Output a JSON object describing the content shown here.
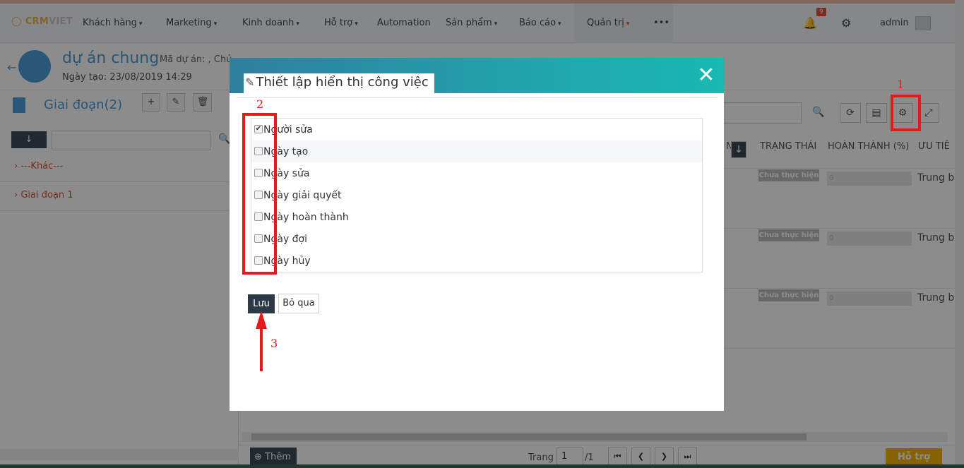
{
  "navbar": {
    "logo_main": "CRM",
    "logo_sub": "VIET",
    "items": [
      {
        "label": "Khách hàng",
        "caret": "▾"
      },
      {
        "label": "Marketing",
        "caret": "▾"
      },
      {
        "label": "Kinh doanh",
        "caret": "▾"
      },
      {
        "label": "Hỗ trợ",
        "caret": "▾"
      },
      {
        "label": "Automation",
        "caret": ""
      },
      {
        "label": "Sản phẩm",
        "caret": "▾"
      },
      {
        "label": "Báo cáo",
        "caret": "▾"
      },
      {
        "label": "Quản trị",
        "caret": "▾"
      },
      {
        "label": "•••",
        "caret": ""
      }
    ],
    "notif_count": "9",
    "user": "admin"
  },
  "project": {
    "title": "dự án chung",
    "code_label": "Mã dự án: ,  Chủ ..",
    "created": "Ngày tạo: 23/08/2019 14:29"
  },
  "left": {
    "stage_title": "Giai đoạn(2)",
    "sort_icon": "↓",
    "groups": [
      {
        "label": "---Khác---"
      },
      {
        "label": "Giai đoạn 1"
      }
    ]
  },
  "right": {
    "columns": [
      "N",
      "TRẠNG THÁI",
      "HOÀN THÀNH (%)",
      "ƯU TIÊ"
    ],
    "rows": [
      {
        "status": "Chưa thực hiện",
        "progress": "0",
        "priority": "Trung b"
      },
      {
        "status": "Chưa thực hiện",
        "progress": "0",
        "priority": "Trung b"
      },
      {
        "status": "Chưa thực hiện",
        "progress": "0",
        "priority": "Trung b"
      }
    ],
    "add_label": "Thêm",
    "page_label": "Trang",
    "page_value": "1",
    "page_total": "/1",
    "help_label": "Hỗ trợ"
  },
  "modal": {
    "title": "Thiết lập hiển thị công việc",
    "close_glyph": "✕",
    "options": [
      {
        "label": "Người sửa",
        "checked": true
      },
      {
        "label": "Ngày tạo",
        "checked": false
      },
      {
        "label": "Ngày sửa",
        "checked": false
      },
      {
        "label": "Ngày giải quyết",
        "checked": false
      },
      {
        "label": "Ngày hoàn thành",
        "checked": false
      },
      {
        "label": "Ngày đợi",
        "checked": false
      },
      {
        "label": "Ngày hủy",
        "checked": false
      }
    ],
    "save_label": "Lưu",
    "cancel_label": "Bỏ qua"
  },
  "annotations": {
    "n1": "1",
    "n2": "2",
    "n3": "3",
    "color": "#e8191a"
  },
  "colors": {
    "accent_blue": "#4c9ed9",
    "header_teal": "#1fa9b0",
    "dark": "#2c3a47",
    "help_yellow": "#f5b400",
    "link_red": "#e74c3c"
  }
}
